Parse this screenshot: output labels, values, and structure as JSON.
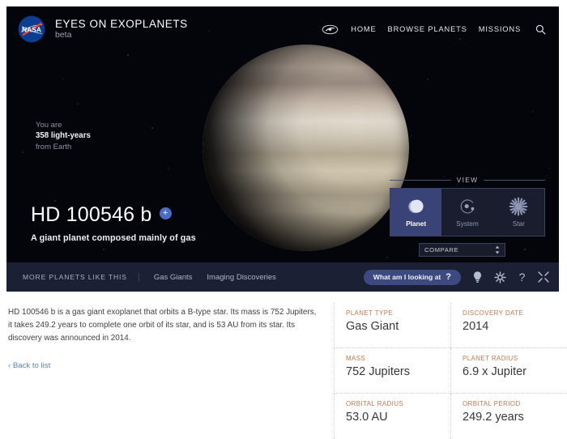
{
  "brand": {
    "logo_icon": "nasa-meatball-logo",
    "title": "EYES ON EXOPLANETS",
    "subtitle": "beta"
  },
  "nav": {
    "galaxy_icon": "galaxy-icon",
    "links": [
      {
        "label": "HOME"
      },
      {
        "label": "BROWSE PLANETS"
      },
      {
        "label": "MISSIONS"
      }
    ],
    "search_icon": "search-icon"
  },
  "distance": {
    "line1": "You are",
    "line2": "358 light-years",
    "line3": "from Earth"
  },
  "planet": {
    "name": "HD 100546 b",
    "plus_badge": "+",
    "tagline": "A giant planet composed mainly of gas"
  },
  "view_panel": {
    "header": "VIEW",
    "options": [
      {
        "label": "Planet",
        "icon": "planet-sphere-icon",
        "selected": true
      },
      {
        "label": "System",
        "icon": "orbit-system-icon",
        "selected": false
      },
      {
        "label": "Star",
        "icon": "star-burst-icon",
        "selected": false
      }
    ],
    "compare": {
      "value": "COMPARE",
      "stepper_icon": "up-down-stepper-icon"
    }
  },
  "toolbar": {
    "heading": "MORE PLANETS LIKE THIS",
    "tags": [
      {
        "label": "Gas Giants"
      },
      {
        "label": "Imaging Discoveries"
      }
    ],
    "wail_button": {
      "label": "What am I looking at",
      "mark": "?"
    },
    "icons": [
      {
        "name": "lightbulb-icon"
      },
      {
        "name": "gear-icon"
      },
      {
        "name": "help-question-icon"
      },
      {
        "name": "expand-collapse-icon"
      }
    ]
  },
  "content": {
    "description": "HD 100546 b is a gas giant exoplanet that orbits a B-type star. Its mass is 752 Jupiters, it takes 249.2 years to complete one orbit of its star, and is 53 AU from its star. Its discovery was announced in 2014.",
    "back_link": "‹ Back to list",
    "facts": [
      {
        "label": "PLANET TYPE",
        "value": "Gas Giant"
      },
      {
        "label": "DISCOVERY DATE",
        "value": "2014"
      },
      {
        "label": "MASS",
        "value": "752 Jupiters"
      },
      {
        "label": "PLANET RADIUS",
        "value": "6.9 x Jupiter"
      },
      {
        "label": "ORBITAL RADIUS",
        "value": "53.0 AU"
      },
      {
        "label": "ORBITAL PERIOD",
        "value": "249.2 years"
      }
    ]
  },
  "colors": {
    "accent_blue": "#3d4a80",
    "badge_blue": "#4b6cc4",
    "label_orange": "#c6764f",
    "link_blue": "#5b7fc4",
    "toolbar_bg": "#1b2035",
    "view_selected": "#3a4377"
  }
}
